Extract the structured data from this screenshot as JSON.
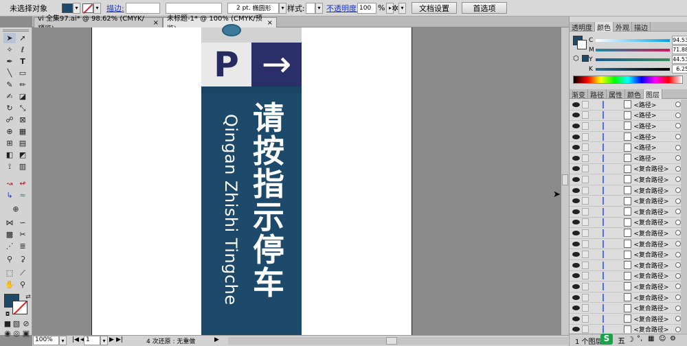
{
  "control_bar": {
    "selection_label": "未选择对象",
    "stroke_label": "描边:",
    "stroke_weight": "2 pt.",
    "brush_shape": "椭圆形",
    "style_label": "样式:",
    "opacity_label": "不透明度:",
    "opacity_value": "100",
    "opacity_unit": "%",
    "doc_setup_label": "文档设置",
    "prefs_label": "首选项"
  },
  "tabs": [
    {
      "label": "vi 全集97.ai* @ 98.62% (CMYK/预览)",
      "close": "×"
    },
    {
      "label": "未标题-1* @ 100% (CMYK/预览)",
      "close": "×"
    }
  ],
  "artwork": {
    "p_letter": "P",
    "arrow": "→",
    "chinese_text": [
      "请",
      "按",
      "指",
      "示",
      "停",
      "车"
    ],
    "pinyin": "Qingan Zhishi Tingche",
    "colors": {
      "navy": "#1d4a6a",
      "band": "#2a2f6a",
      "bg": "#e9e9e9"
    }
  },
  "color_panel": {
    "tabs": [
      "透明度",
      "颜色",
      "外观",
      "描边"
    ],
    "channels": [
      {
        "label": "C",
        "value": "94.53"
      },
      {
        "label": "M",
        "value": "71.88"
      },
      {
        "label": "Y",
        "value": "44.53"
      },
      {
        "label": "K",
        "value": "6.25"
      }
    ]
  },
  "layers_panel": {
    "tabs": [
      "渐变",
      "路径",
      "属性",
      "颜色",
      "图层"
    ],
    "rows": [
      "<路径>",
      "<路径>",
      "<路径>",
      "<路径>",
      "<路径>",
      "<路径>",
      "<复合路径>",
      "<复合路径>",
      "<复合路径>",
      "<复合路径>",
      "<复合路径>",
      "<复合路径>",
      "<复合路径>",
      "<复合路径>",
      "<复合路径>",
      "<复合路径>",
      "<复合路径>",
      "<复合路径>",
      "<复合路径>",
      "<复合路径>",
      "<复合路径>",
      "<复合路径>"
    ],
    "footer_label": "1 个图层"
  },
  "status_bar": {
    "zoom": "100%",
    "page": "1",
    "undo_text": "4 次还原 : 无重做"
  },
  "ime": {
    "label": "五"
  }
}
